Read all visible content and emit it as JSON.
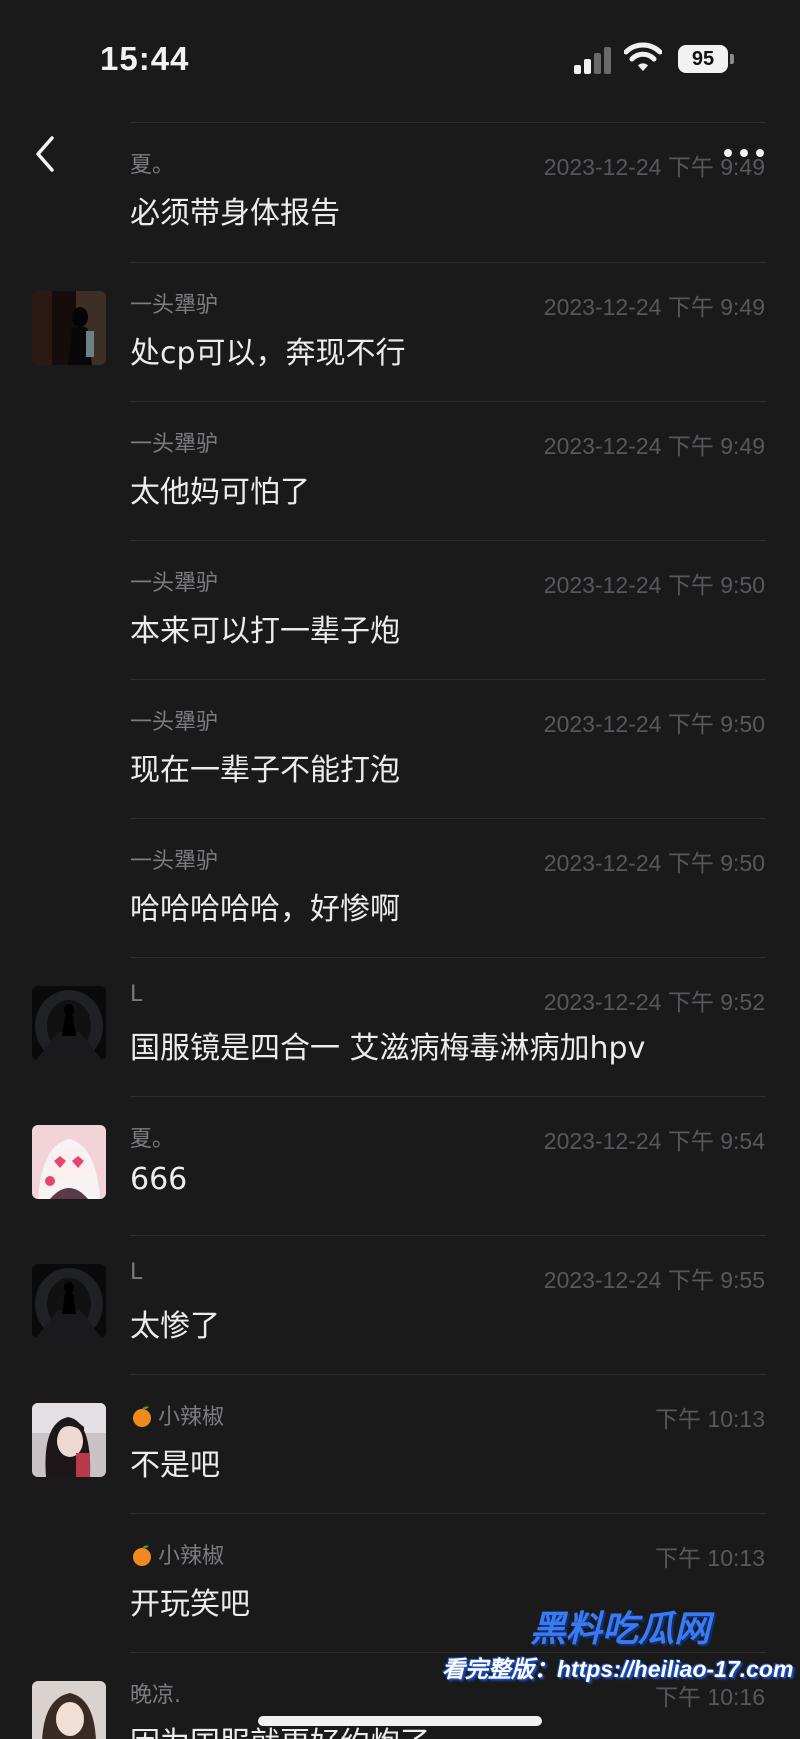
{
  "status_bar": {
    "time": "15:44",
    "battery": "95"
  },
  "messages": [
    {
      "sender": "夏。",
      "time": "2023-12-24 下午 9:49",
      "text": "必须带身体报告",
      "avatar": "none"
    },
    {
      "sender": "一头犟驴",
      "time": "2023-12-24 下午 9:49",
      "text": "处cp可以，奔现不行",
      "avatar": "dark-silhouette"
    },
    {
      "sender": "一头犟驴",
      "time": "2023-12-24 下午 9:49",
      "text": "太他妈可怕了",
      "avatar": "none"
    },
    {
      "sender": "一头犟驴",
      "time": "2023-12-24 下午 9:50",
      "text": "本来可以打一辈子炮",
      "avatar": "none"
    },
    {
      "sender": "一头犟驴",
      "time": "2023-12-24 下午 9:50",
      "text": "现在一辈子不能打泡",
      "avatar": "none"
    },
    {
      "sender": "一头犟驴",
      "time": "2023-12-24 下午 9:50",
      "text": "哈哈哈哈哈，好惨啊",
      "avatar": "none"
    },
    {
      "sender": "L",
      "time": "2023-12-24 下午 9:52",
      "text": "国服镜是四合一  艾滋病梅毒淋病加hpv",
      "avatar": "tunnel-figure"
    },
    {
      "sender": "夏。",
      "time": "2023-12-24 下午 9:54",
      "text": "666",
      "avatar": "anime-girl"
    },
    {
      "sender": "L",
      "time": "2023-12-24 下午 9:55",
      "text": "太惨了",
      "avatar": "tunnel-figure"
    },
    {
      "sender": "小辣椒",
      "time": "下午 10:13",
      "text": "不是吧",
      "avatar": "girl-photo",
      "emoji": "orange-icon"
    },
    {
      "sender": "小辣椒",
      "time": "下午 10:13",
      "text": "开玩笑吧",
      "avatar": "none",
      "emoji": "orange-icon"
    },
    {
      "sender": "晚凉.",
      "time": "下午 10:16",
      "text": "因为国服就更好约炮了",
      "avatar": "woman-portrait"
    }
  ],
  "watermark": {
    "logo": "黑料吃瓜网",
    "url": "看完整版：https://heiliao-17.com"
  },
  "colors": {
    "background": "#1a1a1b",
    "text": "#ececec",
    "meta": "#7c7c80",
    "watermark_blue": "#3a7cf0"
  }
}
